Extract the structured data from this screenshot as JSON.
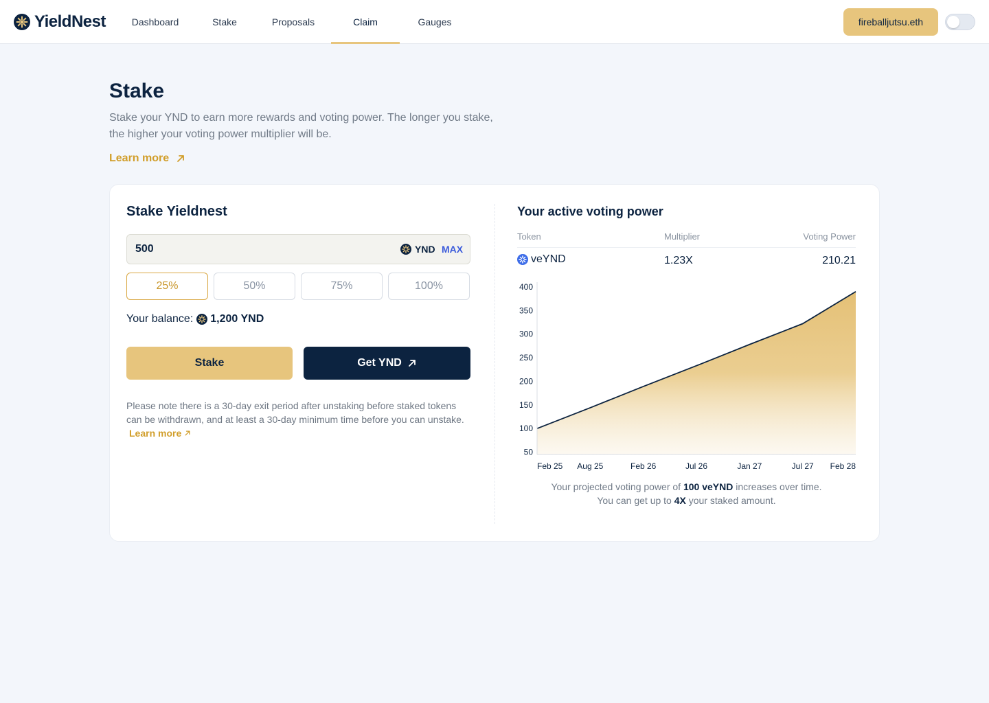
{
  "header": {
    "brand": "YieldNest",
    "nav": [
      {
        "label": "Dashboard",
        "active": false
      },
      {
        "label": "Stake",
        "active": false
      },
      {
        "label": "Proposals",
        "active": false
      },
      {
        "label": "Claim",
        "active": true
      },
      {
        "label": "Gauges",
        "active": false
      }
    ],
    "wallet": "fireballjutsu.eth",
    "theme_toggle": "off"
  },
  "page": {
    "title": "Stake",
    "description": "Stake your YND to earn more rewards and voting power. The longer you stake, the higher your voting power multiplier will be.",
    "learn_more": "Learn more"
  },
  "stake_form": {
    "title": "Stake Yieldnest",
    "amount": "500",
    "token": "YND",
    "max_label": "MAX",
    "percent_options": [
      "25%",
      "50%",
      "75%",
      "100%"
    ],
    "selected_percent": "25%",
    "balance_label": "Your balance:",
    "balance_value": "1,200 YND",
    "stake_button": "Stake",
    "get_button": "Get YND",
    "note": "Please note there is a 30-day exit period after unstaking before staked tokens can be withdrawn, and at least a 30-day minimum time before you can unstake.",
    "note_link": "Learn more"
  },
  "voting_power": {
    "title": "Your active voting power",
    "columns": [
      "Token",
      "Multiplier",
      "Voting Power"
    ],
    "row": {
      "token": "veYND",
      "multiplier": "1.23X",
      "voting_power": "210.21"
    },
    "caption": {
      "part1": "Your projected voting power of ",
      "amount": "100 veYND",
      "part2": " increases over time.",
      "part3": "You can get up to ",
      "max_mult": "4X",
      "part4": " your staked amount."
    }
  },
  "colors": {
    "accent": "#e7c57d",
    "navy": "#0c2340",
    "link": "#d19e2a",
    "max": "#3b5bdb"
  },
  "chart_data": {
    "type": "area",
    "x": [
      "Feb 25",
      "Aug 25",
      "Feb 26",
      "Jul 26",
      "Jan 27",
      "Jul 27",
      "Feb 28"
    ],
    "series": [
      {
        "values": [
          100,
          144,
          189,
          233,
          278,
          322,
          390
        ]
      }
    ],
    "yticks": [
      400,
      350,
      300,
      250,
      200,
      150,
      100,
      50
    ],
    "ylim": [
      45,
      410
    ],
    "grid": false
  }
}
